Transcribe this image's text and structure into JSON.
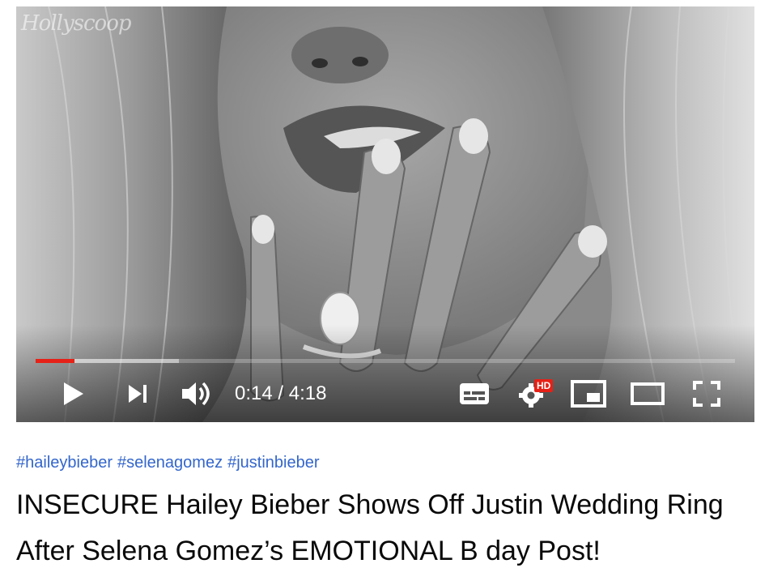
{
  "player": {
    "watermark": "Hollyscoop",
    "progress": {
      "played_fraction": 0.056,
      "buffered_fraction": 0.205
    },
    "current_time": "0:14",
    "duration": "4:18",
    "time_separator": " / ",
    "quality_badge": "HD",
    "accent_color": "#e62117",
    "icons": [
      "play-icon",
      "next-icon",
      "volume-icon",
      "subtitles-icon",
      "settings-icon",
      "miniplayer-icon",
      "theater-mode-icon",
      "fullscreen-icon"
    ]
  },
  "video": {
    "hashtags": [
      "#haileybieber",
      "#selenagomez",
      "#justinbieber"
    ],
    "title_line1": "INSECURE Hailey Bieber Shows Off Justin Wedding Ring",
    "title_line2": "After Selena Gomez’s EMOTIONAL B day Post!"
  }
}
